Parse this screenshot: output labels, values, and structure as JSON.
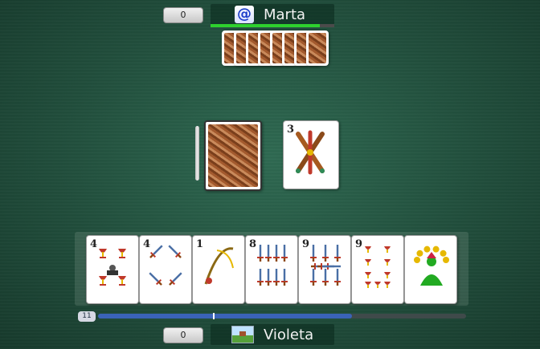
{
  "top_player": {
    "score": "0",
    "name": "Marta",
    "avatar_icon": "at-sign-icon",
    "turn_progress": 0.88,
    "hidden_cards": 8
  },
  "table": {
    "deck": {
      "icon": "card-back"
    },
    "trump_card": {
      "rank": "3",
      "suit": "bastos"
    }
  },
  "hand": [
    {
      "rank": "4",
      "suit": "copas"
    },
    {
      "rank": "4",
      "suit": "espadas"
    },
    {
      "rank": "1",
      "suit": "espadas"
    },
    {
      "rank": "8",
      "suit": "espadas"
    },
    {
      "rank": "9",
      "suit": "espadas"
    },
    {
      "rank": "9",
      "suit": "copas"
    },
    {
      "rank": "",
      "suit": "comodín"
    }
  ],
  "bottom_player": {
    "score": "0",
    "name": "Violeta",
    "avatar_icon": "landscape-icon",
    "counter": "11",
    "timer_progress": 0.69
  },
  "colors": {
    "felt": "#214e3c",
    "progress_green": "#2ed12e",
    "timer_blue": "#3a63b8",
    "copas_red": "#c0392b",
    "joker_green": "#22aa22"
  }
}
